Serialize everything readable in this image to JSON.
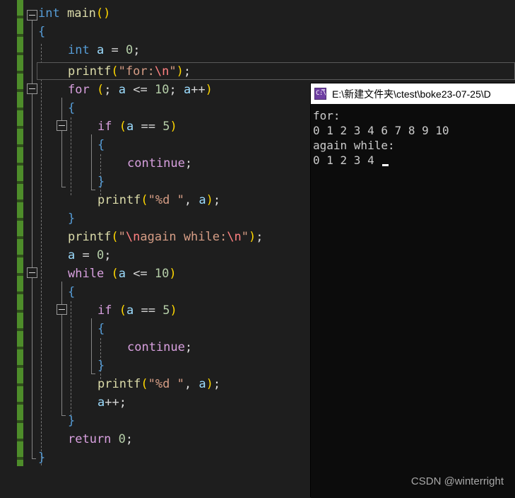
{
  "editor": {
    "background": "#1e1e1e",
    "change_bar_color": "#56a02c",
    "current_line_index": 4,
    "lines": [
      "int main()",
      "{",
      "    int a = 0;",
      "    printf(\"for:\\n\");",
      "    for (; a <= 10; a++)",
      "    {",
      "        if (a == 5)",
      "        {",
      "            continue;",
      "        }",
      "        printf(\"%d \", a);",
      "    }",
      "    printf(\"\\nagain while:\\n\");",
      "    a = 0;",
      "    while (a <= 10)",
      "    {",
      "        if (a == 5)",
      "        {",
      "            continue;",
      "        }",
      "        printf(\"%d \", a);",
      "        a++;",
      "    }",
      "    return 0;",
      "}"
    ],
    "fold_markers": [
      "int main()",
      "for",
      "if",
      "while",
      "if"
    ]
  },
  "console": {
    "title": "E:\\新建文件夹\\ctest\\boke23-07-25\\D",
    "icon": "console-window-icon",
    "icon_glyph": "C:\\",
    "background": "#0c0c0c",
    "text_color": "#cccccc",
    "output_lines": [
      "for:",
      "0 1 2 3 4 6 7 8 9 10",
      "again while:",
      "0 1 2 3 4 "
    ],
    "cursor_visible": true
  },
  "watermark": {
    "text": "CSDN @winterright"
  }
}
